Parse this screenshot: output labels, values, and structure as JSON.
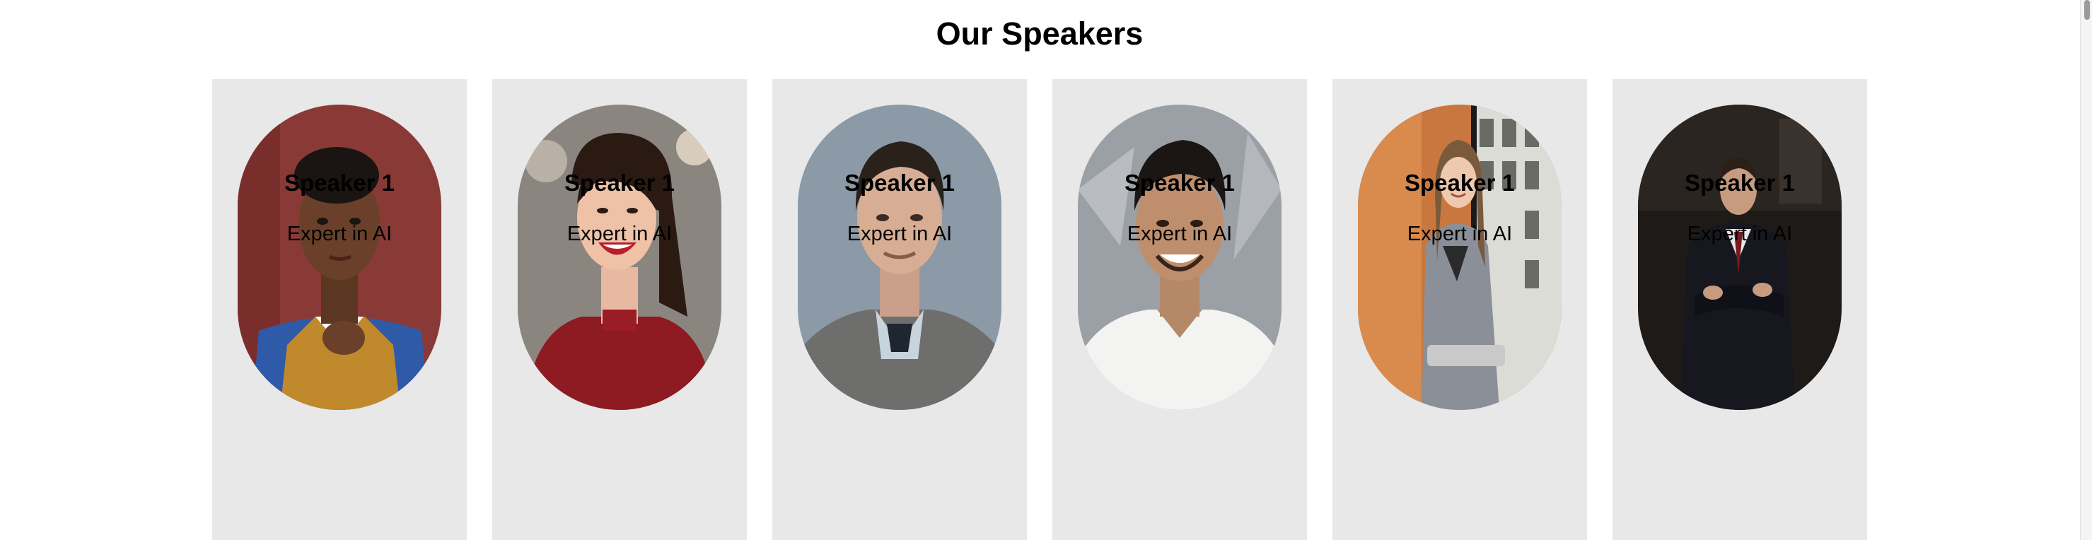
{
  "section": {
    "title": "Our Speakers"
  },
  "speakers": [
    {
      "name": "Speaker 1",
      "role": "Expert in AI",
      "photo": "portrait-woman-short-hair"
    },
    {
      "name": "Speaker 1",
      "role": "Expert in AI",
      "photo": "portrait-woman-red-sweater"
    },
    {
      "name": "Speaker 1",
      "role": "Expert in AI",
      "photo": "portrait-man-grey-sweater"
    },
    {
      "name": "Speaker 1",
      "role": "Expert in AI",
      "photo": "portrait-man-white-tshirt"
    },
    {
      "name": "Speaker 1",
      "role": "Expert in AI",
      "photo": "portrait-woman-blazer-window"
    },
    {
      "name": "Speaker 1",
      "role": "Expert in AI",
      "photo": "portrait-man-suit-dark"
    }
  ],
  "colors": {
    "card_background": "#e8e8e8",
    "page_background": "#ffffff",
    "text": "#000000"
  }
}
